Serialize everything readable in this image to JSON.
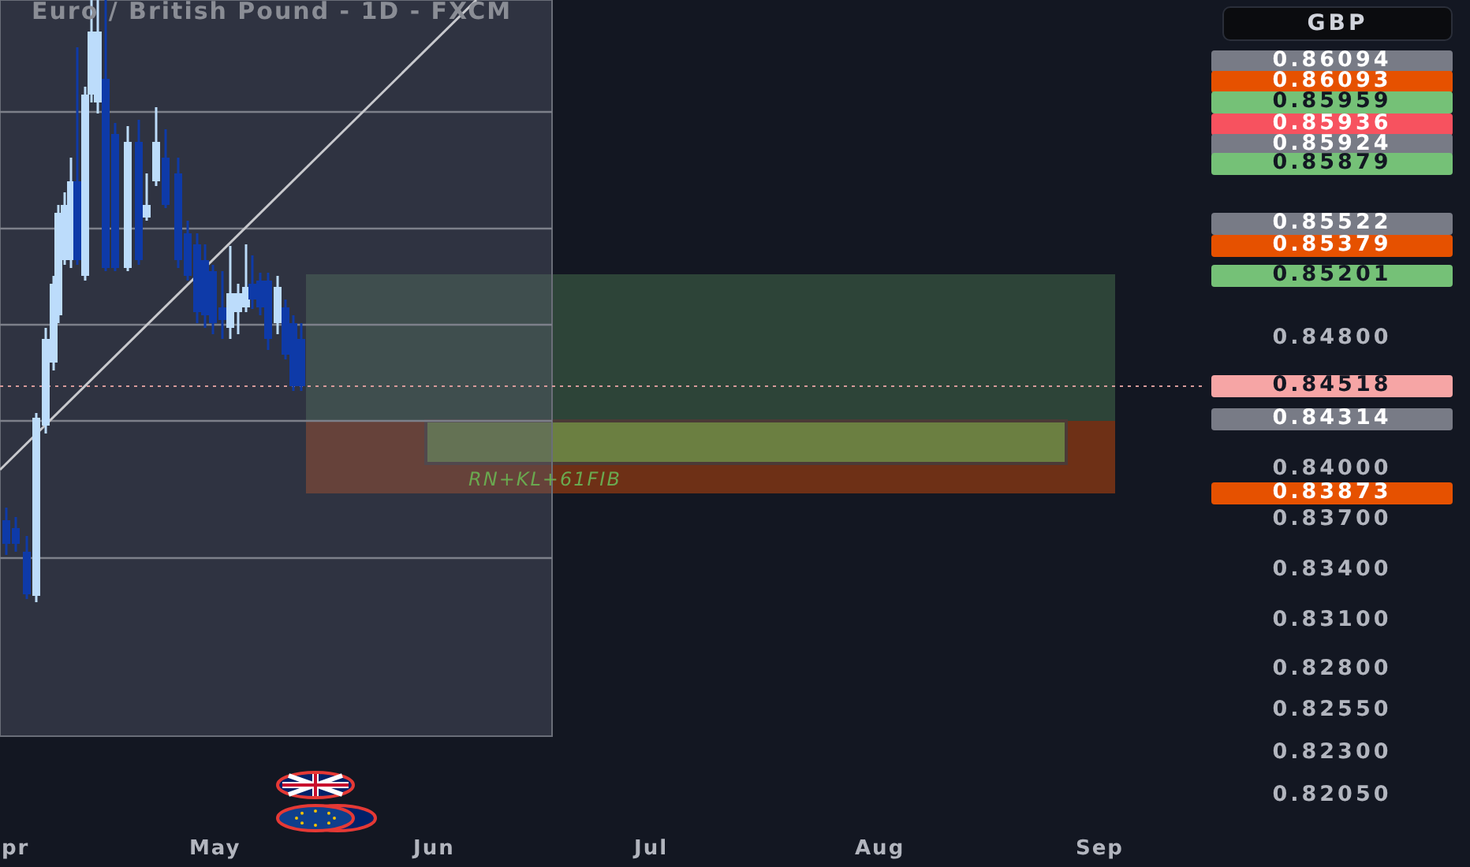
{
  "chart": {
    "title": "Euro / British Pound - 1D - FXCM",
    "zone_label": "RN+KL+61FIB"
  },
  "price_axis": {
    "currency": "GBP",
    "labels": [
      {
        "text": "0.86094",
        "kind": "tag",
        "color": "#787b86"
      },
      {
        "text": "0.86093",
        "kind": "tag",
        "color": "#e65100"
      },
      {
        "text": "0.85959",
        "kind": "tag",
        "color": "#75c177"
      },
      {
        "text": "0.85936",
        "kind": "tag",
        "color": "#f7525f"
      },
      {
        "text": "0.85924",
        "kind": "tag",
        "color": "#787b86"
      },
      {
        "text": "0.85879",
        "kind": "tag",
        "color": "#75c177"
      },
      {
        "text": "0.85522",
        "kind": "tag",
        "color": "#787b86"
      },
      {
        "text": "0.85379",
        "kind": "tag",
        "color": "#e65100"
      },
      {
        "text": "0.85201",
        "kind": "tag",
        "color": "#75c177"
      },
      {
        "text": "0.84800",
        "kind": "tick"
      },
      {
        "text": "0.84518",
        "kind": "tag",
        "color": "#f6a5a5"
      },
      {
        "text": "0.84314",
        "kind": "tag",
        "color": "#787b86"
      },
      {
        "text": "0.84000",
        "kind": "tick"
      },
      {
        "text": "0.83873",
        "kind": "tag",
        "color": "#e65100"
      },
      {
        "text": "0.83700",
        "kind": "tick"
      },
      {
        "text": "0.83400",
        "kind": "tick"
      },
      {
        "text": "0.83100",
        "kind": "tick"
      },
      {
        "text": "0.82800",
        "kind": "tick"
      },
      {
        "text": "0.82550",
        "kind": "tick"
      },
      {
        "text": "0.82300",
        "kind": "tick"
      },
      {
        "text": "0.82050",
        "kind": "tick"
      }
    ]
  },
  "time_axis": [
    "pr",
    "May",
    "Jun",
    "Jul",
    "Aug",
    "Sep"
  ]
}
